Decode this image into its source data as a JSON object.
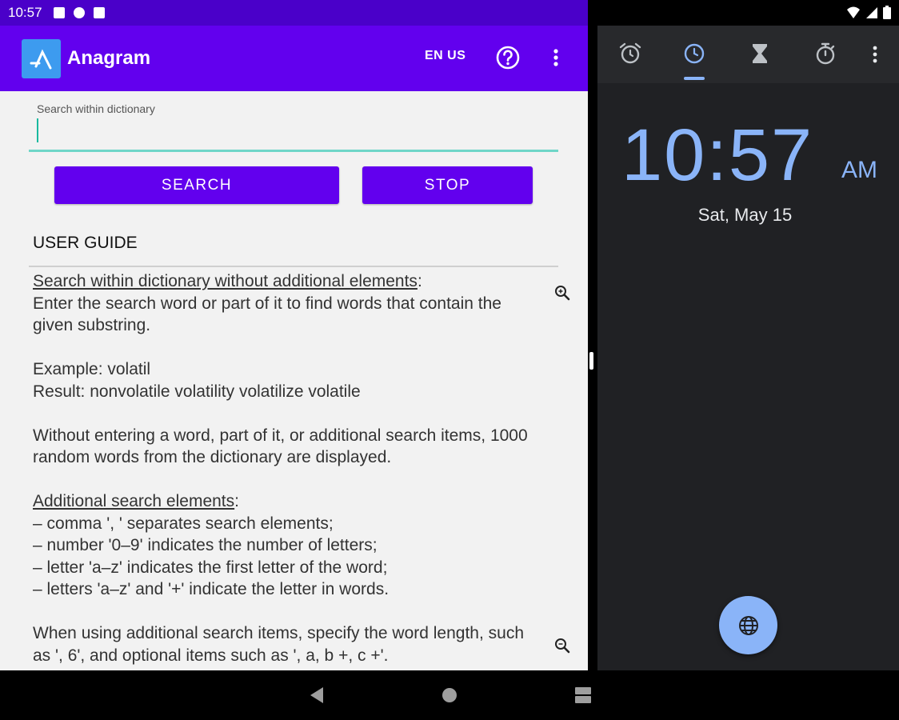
{
  "left_app": {
    "status_bar": {
      "time": "10:57"
    },
    "app_bar": {
      "title": "Anagram",
      "language_label": "EN US",
      "help_icon": "help-circle-icon",
      "more_icon": "more-vert-icon"
    },
    "search": {
      "label": "Search within dictionary",
      "value": "",
      "search_button": "SEARCH",
      "stop_button": "STOP"
    },
    "guide": {
      "heading": "USER GUIDE",
      "section1_title": "Search within dictionary without additional elements",
      "section1_body": "Enter the search word or part of it to find words that contain the given substring.",
      "example": "Example: volatil",
      "result": "Result: nonvolatile volatility volatilize volatile",
      "random_note": "Without entering a word, part of it, or additional search items, 1000 random words from the dictionary are displayed.",
      "section2_title": "Additional search elements",
      "rules": [
        "– comma ', ' separates search elements;",
        "– number '0–9' indicates the number of letters;",
        "– letter 'a–z' indicates the first letter of the word;",
        "– letters 'a–z' and '+' indicate the letter in words."
      ],
      "additional_note": "When using additional search items, specify the word length, such as ', 6', and optional items such as ', a, b +, c +'."
    }
  },
  "right_app": {
    "tabs": [
      "alarm-icon",
      "clock-icon",
      "timer-icon",
      "stopwatch-icon"
    ],
    "active_tab": "clock",
    "time": "10:57",
    "ampm": "AM",
    "date": "Sat, May 15",
    "fab_icon": "globe-icon"
  },
  "colors": {
    "primary": "#6200ee",
    "primary_dark": "#4a00c9",
    "accent_teal": "#6fd6c8",
    "clock_blue": "#8ab4f8",
    "clock_bg": "#202124"
  }
}
